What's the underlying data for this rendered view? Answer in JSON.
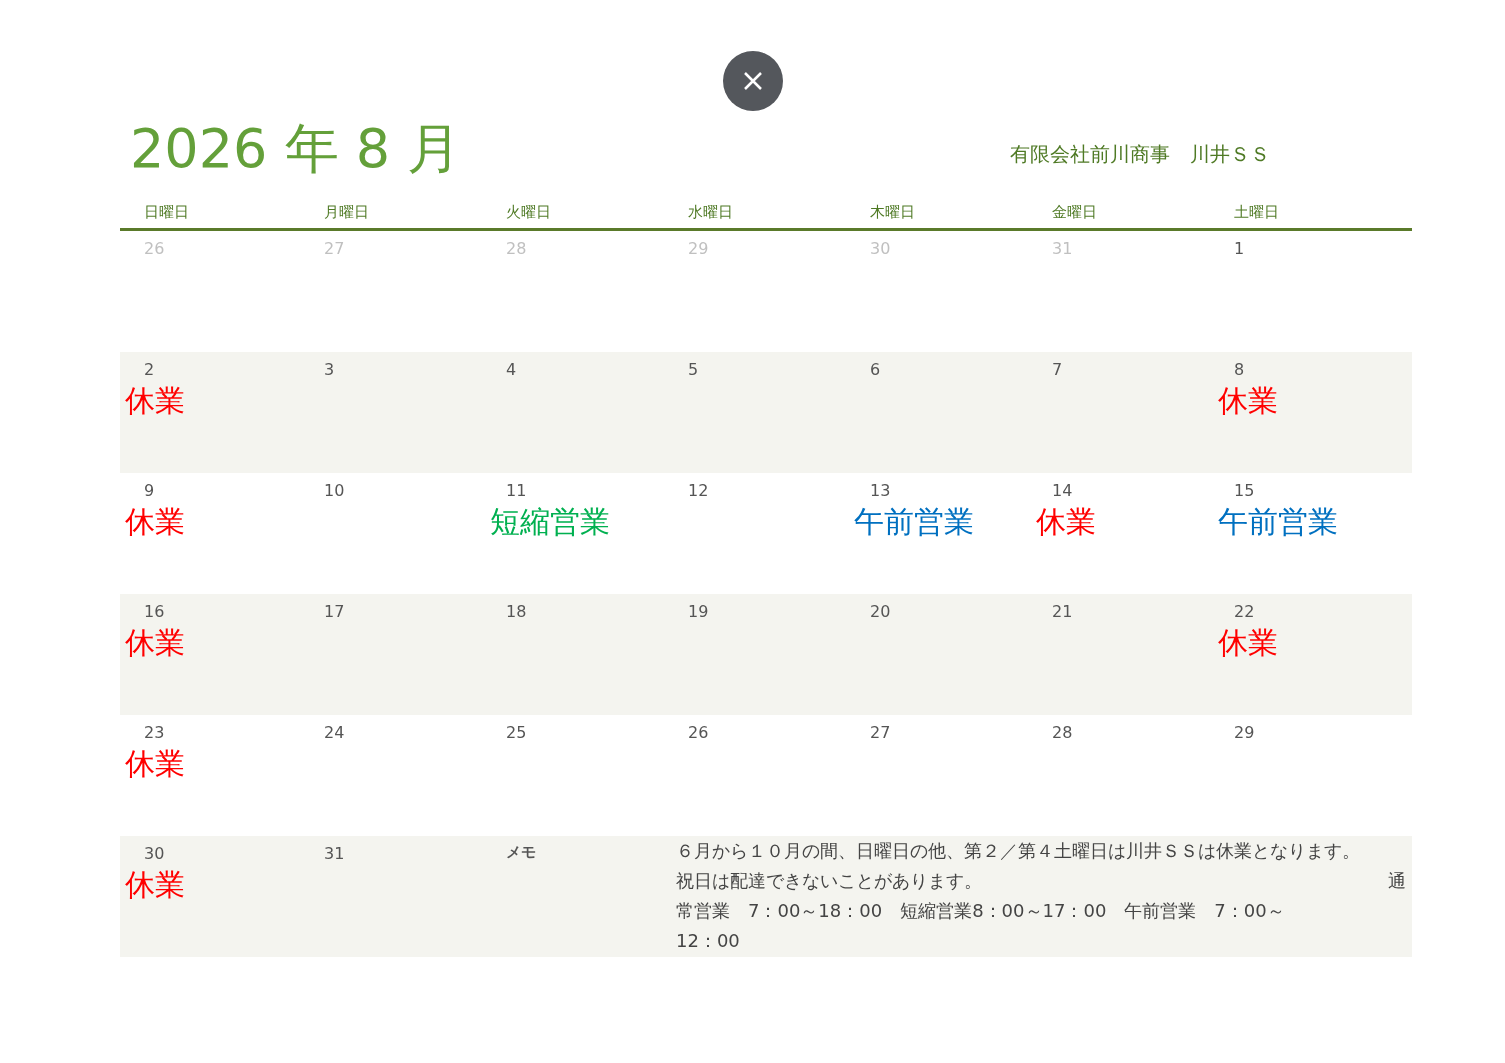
{
  "title": "2026 年 8 月",
  "company": "有限会社前川商事　川井ＳＳ",
  "weekdays": [
    "日曜日",
    "月曜日",
    "火曜日",
    "水曜日",
    "木曜日",
    "金曜日",
    "土曜日"
  ],
  "weeks": [
    [
      {
        "day": "26",
        "muted": true
      },
      {
        "day": "27",
        "muted": true
      },
      {
        "day": "28",
        "muted": true
      },
      {
        "day": "29",
        "muted": true
      },
      {
        "day": "30",
        "muted": true
      },
      {
        "day": "31",
        "muted": true
      },
      {
        "day": "1",
        "muted": false
      }
    ],
    [
      {
        "day": "2",
        "muted": false,
        "status": {
          "text": "休業",
          "kind": "closed"
        }
      },
      {
        "day": "3",
        "muted": false
      },
      {
        "day": "4",
        "muted": false
      },
      {
        "day": "5",
        "muted": false
      },
      {
        "day": "6",
        "muted": false
      },
      {
        "day": "7",
        "muted": false
      },
      {
        "day": "8",
        "muted": false,
        "status": {
          "text": "休業",
          "kind": "closed"
        }
      }
    ],
    [
      {
        "day": "9",
        "muted": false,
        "status": {
          "text": "休業",
          "kind": "closed"
        }
      },
      {
        "day": "10",
        "muted": false
      },
      {
        "day": "11",
        "muted": false,
        "status": {
          "text": "短縮営業",
          "kind": "short"
        }
      },
      {
        "day": "12",
        "muted": false
      },
      {
        "day": "13",
        "muted": false,
        "status": {
          "text": "午前営業",
          "kind": "morning"
        }
      },
      {
        "day": "14",
        "muted": false,
        "status": {
          "text": "休業",
          "kind": "closed"
        }
      },
      {
        "day": "15",
        "muted": false,
        "status": {
          "text": "午前営業",
          "kind": "morning"
        }
      }
    ],
    [
      {
        "day": "16",
        "muted": false,
        "status": {
          "text": "休業",
          "kind": "closed"
        }
      },
      {
        "day": "17",
        "muted": false
      },
      {
        "day": "18",
        "muted": false
      },
      {
        "day": "19",
        "muted": false
      },
      {
        "day": "20",
        "muted": false
      },
      {
        "day": "21",
        "muted": false
      },
      {
        "day": "22",
        "muted": false,
        "status": {
          "text": "休業",
          "kind": "closed"
        }
      }
    ],
    [
      {
        "day": "23",
        "muted": false,
        "status": {
          "text": "休業",
          "kind": "closed"
        }
      },
      {
        "day": "24",
        "muted": false
      },
      {
        "day": "25",
        "muted": false
      },
      {
        "day": "26",
        "muted": false
      },
      {
        "day": "27",
        "muted": false
      },
      {
        "day": "28",
        "muted": false
      },
      {
        "day": "29",
        "muted": false
      }
    ],
    [
      {
        "day": "30",
        "muted": false,
        "status": {
          "text": "休業",
          "kind": "closed"
        }
      },
      {
        "day": "31",
        "muted": false
      }
    ]
  ],
  "memo": {
    "label": "メモ",
    "lines": [
      [
        "６月から１０月の間、日曜日の他、第２／第４土曜日は川井ＳＳは休業となります。"
      ],
      [
        "祝日は配達できないことがあります。",
        "通"
      ],
      [
        "常営業　7：00～18：00　短縮営業8：00～17：00　午前営業　7：00～"
      ],
      [
        "12：00"
      ]
    ]
  }
}
